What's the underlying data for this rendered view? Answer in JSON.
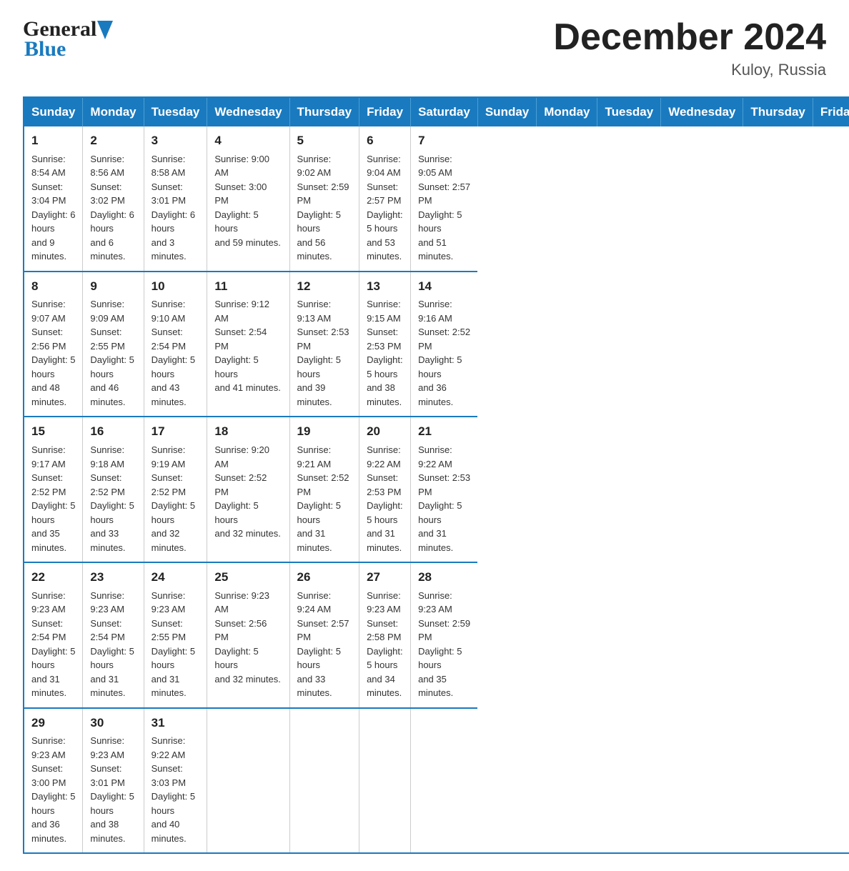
{
  "header": {
    "logo_general": "General",
    "logo_blue": "Blue",
    "month_title": "December 2024",
    "location": "Kuloy, Russia"
  },
  "days_of_week": [
    "Sunday",
    "Monday",
    "Tuesday",
    "Wednesday",
    "Thursday",
    "Friday",
    "Saturday"
  ],
  "weeks": [
    [
      {
        "day": "1",
        "sunrise": "8:54 AM",
        "sunset": "3:04 PM",
        "daylight": "6 hours and 9 minutes."
      },
      {
        "day": "2",
        "sunrise": "8:56 AM",
        "sunset": "3:02 PM",
        "daylight": "6 hours and 6 minutes."
      },
      {
        "day": "3",
        "sunrise": "8:58 AM",
        "sunset": "3:01 PM",
        "daylight": "6 hours and 3 minutes."
      },
      {
        "day": "4",
        "sunrise": "9:00 AM",
        "sunset": "3:00 PM",
        "daylight": "5 hours and 59 minutes."
      },
      {
        "day": "5",
        "sunrise": "9:02 AM",
        "sunset": "2:59 PM",
        "daylight": "5 hours and 56 minutes."
      },
      {
        "day": "6",
        "sunrise": "9:04 AM",
        "sunset": "2:57 PM",
        "daylight": "5 hours and 53 minutes."
      },
      {
        "day": "7",
        "sunrise": "9:05 AM",
        "sunset": "2:57 PM",
        "daylight": "5 hours and 51 minutes."
      }
    ],
    [
      {
        "day": "8",
        "sunrise": "9:07 AM",
        "sunset": "2:56 PM",
        "daylight": "5 hours and 48 minutes."
      },
      {
        "day": "9",
        "sunrise": "9:09 AM",
        "sunset": "2:55 PM",
        "daylight": "5 hours and 46 minutes."
      },
      {
        "day": "10",
        "sunrise": "9:10 AM",
        "sunset": "2:54 PM",
        "daylight": "5 hours and 43 minutes."
      },
      {
        "day": "11",
        "sunrise": "9:12 AM",
        "sunset": "2:54 PM",
        "daylight": "5 hours and 41 minutes."
      },
      {
        "day": "12",
        "sunrise": "9:13 AM",
        "sunset": "2:53 PM",
        "daylight": "5 hours and 39 minutes."
      },
      {
        "day": "13",
        "sunrise": "9:15 AM",
        "sunset": "2:53 PM",
        "daylight": "5 hours and 38 minutes."
      },
      {
        "day": "14",
        "sunrise": "9:16 AM",
        "sunset": "2:52 PM",
        "daylight": "5 hours and 36 minutes."
      }
    ],
    [
      {
        "day": "15",
        "sunrise": "9:17 AM",
        "sunset": "2:52 PM",
        "daylight": "5 hours and 35 minutes."
      },
      {
        "day": "16",
        "sunrise": "9:18 AM",
        "sunset": "2:52 PM",
        "daylight": "5 hours and 33 minutes."
      },
      {
        "day": "17",
        "sunrise": "9:19 AM",
        "sunset": "2:52 PM",
        "daylight": "5 hours and 32 minutes."
      },
      {
        "day": "18",
        "sunrise": "9:20 AM",
        "sunset": "2:52 PM",
        "daylight": "5 hours and 32 minutes."
      },
      {
        "day": "19",
        "sunrise": "9:21 AM",
        "sunset": "2:52 PM",
        "daylight": "5 hours and 31 minutes."
      },
      {
        "day": "20",
        "sunrise": "9:22 AM",
        "sunset": "2:53 PM",
        "daylight": "5 hours and 31 minutes."
      },
      {
        "day": "21",
        "sunrise": "9:22 AM",
        "sunset": "2:53 PM",
        "daylight": "5 hours and 31 minutes."
      }
    ],
    [
      {
        "day": "22",
        "sunrise": "9:23 AM",
        "sunset": "2:54 PM",
        "daylight": "5 hours and 31 minutes."
      },
      {
        "day": "23",
        "sunrise": "9:23 AM",
        "sunset": "2:54 PM",
        "daylight": "5 hours and 31 minutes."
      },
      {
        "day": "24",
        "sunrise": "9:23 AM",
        "sunset": "2:55 PM",
        "daylight": "5 hours and 31 minutes."
      },
      {
        "day": "25",
        "sunrise": "9:23 AM",
        "sunset": "2:56 PM",
        "daylight": "5 hours and 32 minutes."
      },
      {
        "day": "26",
        "sunrise": "9:24 AM",
        "sunset": "2:57 PM",
        "daylight": "5 hours and 33 minutes."
      },
      {
        "day": "27",
        "sunrise": "9:23 AM",
        "sunset": "2:58 PM",
        "daylight": "5 hours and 34 minutes."
      },
      {
        "day": "28",
        "sunrise": "9:23 AM",
        "sunset": "2:59 PM",
        "daylight": "5 hours and 35 minutes."
      }
    ],
    [
      {
        "day": "29",
        "sunrise": "9:23 AM",
        "sunset": "3:00 PM",
        "daylight": "5 hours and 36 minutes."
      },
      {
        "day": "30",
        "sunrise": "9:23 AM",
        "sunset": "3:01 PM",
        "daylight": "5 hours and 38 minutes."
      },
      {
        "day": "31",
        "sunrise": "9:22 AM",
        "sunset": "3:03 PM",
        "daylight": "5 hours and 40 minutes."
      },
      null,
      null,
      null,
      null
    ]
  ],
  "labels": {
    "sunrise": "Sunrise:",
    "sunset": "Sunset:",
    "daylight": "Daylight:"
  }
}
